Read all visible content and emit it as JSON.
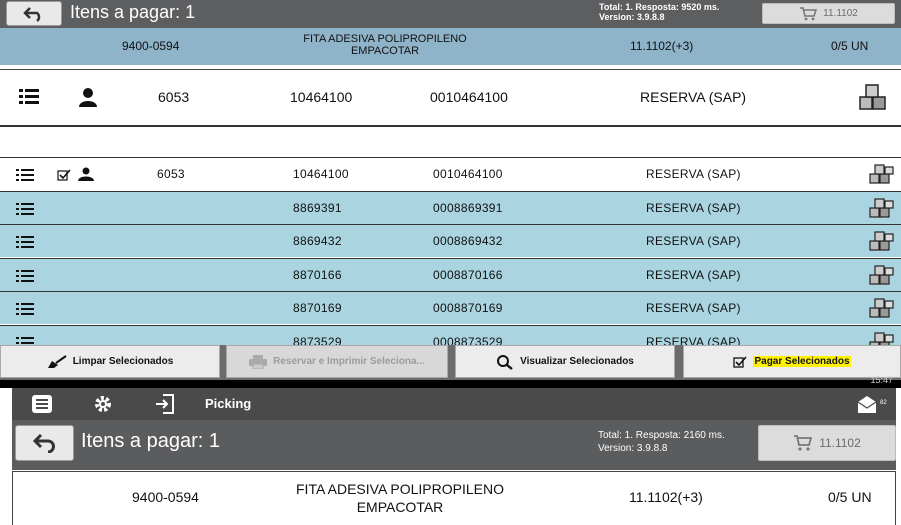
{
  "top_header": {
    "title": "Itens a pagar: 1",
    "info_line1": "Total: 1. Resposta: 9520 ms.",
    "info_line2": "Version: 3.9.8.8",
    "cart_value": "11.1102"
  },
  "product_summary": {
    "code": "9400-0594",
    "description_line1": "FITA ADESIVA POLIPROPILENO",
    "description_line2": "EMPACOTAR",
    "quantity": "11.1102(+3)",
    "units": "0/5 UN"
  },
  "selected_row": {
    "id": "6053",
    "code": "10464100",
    "code_full": "0010464100",
    "type": "RESERVA (SAP)"
  },
  "list_rows": [
    {
      "id": "6053",
      "code": "10464100",
      "code_full": "0010464100",
      "type": "RESERVA (SAP)"
    },
    {
      "id": "",
      "code": "8869391",
      "code_full": "0008869391",
      "type": "RESERVA (SAP)"
    },
    {
      "id": "",
      "code": "8869432",
      "code_full": "0008869432",
      "type": "RESERVA (SAP)"
    },
    {
      "id": "",
      "code": "8870166",
      "code_full": "0008870166",
      "type": "RESERVA (SAP)"
    },
    {
      "id": "",
      "code": "8870169",
      "code_full": "0008870169",
      "type": "RESERVA (SAP)"
    },
    {
      "id": "",
      "code": "8873529",
      "code_full": "0008873529",
      "type": "RESERVA (SAP)"
    }
  ],
  "action_buttons": {
    "clear": "Limpar Selecionados",
    "reserve_print": "Reservar e Imprimir Seleciona...",
    "view": "Visualizar Selecionados",
    "pay": "Pagar Selecionados"
  },
  "status_bar": {
    "time": "15:47"
  },
  "nav": {
    "title": "Picking",
    "mail_count": "82"
  },
  "bottom_header": {
    "title": "Itens a pagar: 1",
    "info_line1": "Total: 1. Resposta: 2160 ms.",
    "info_line2": "Version: 3.9.8.8",
    "cart_value": "11.1102"
  },
  "bottom_product": {
    "code": "9400-0594",
    "description_line1": "FITA ADESIVA POLIPROPILENO",
    "description_line2": "EMPACOTAR",
    "quantity": "11.1102(+3)",
    "units": "0/5 UN"
  },
  "colors": {
    "header_gray": "#5d5e60",
    "row_blue": "#a9d4e0",
    "summary_blue": "#8fb3c9",
    "highlight_yellow": "#fff200"
  }
}
